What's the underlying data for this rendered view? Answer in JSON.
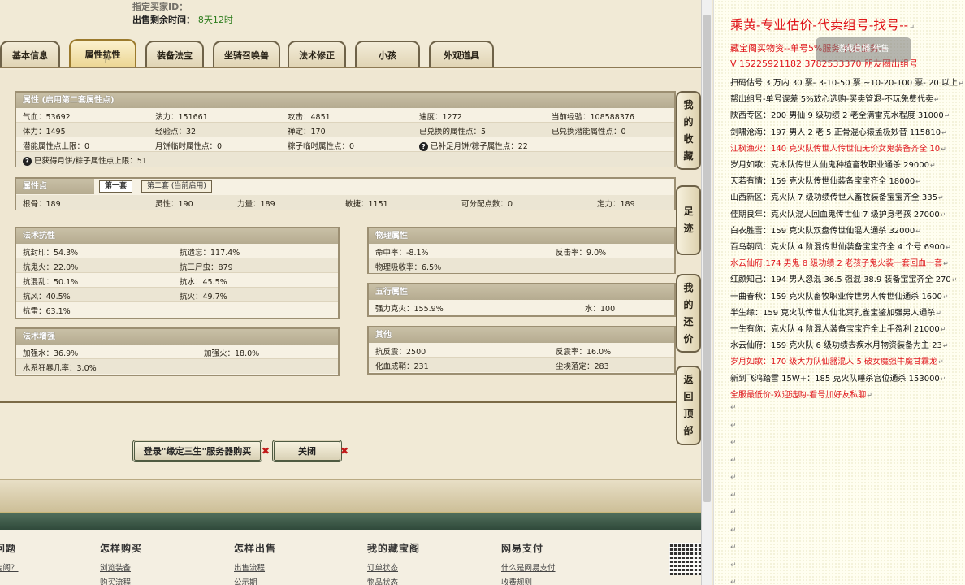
{
  "header": {
    "partial_line": "指定买家ID：",
    "time_label": "出售剩余时间：",
    "time_value": "8天12时"
  },
  "tabs": [
    {
      "label": "基本信息"
    },
    {
      "label": "属性抗性"
    },
    {
      "label": "装备法宝"
    },
    {
      "label": "坐骑召唤兽"
    },
    {
      "label": "法术修正"
    },
    {
      "label": "小孩"
    },
    {
      "label": "外观道具"
    }
  ],
  "attributes": {
    "title": "属性 (启用第二套属性点)",
    "row1": [
      "气血：53692",
      "法力：151661",
      "攻击：4851",
      "速度：1272",
      "当前经验：108588376"
    ],
    "row2": [
      "体力：1495",
      "经验点：32",
      "禅定：170",
      "已兑换的属性点：5",
      "已兑换潜能属性点：0"
    ],
    "row3": [
      "潜能属性点上限：0",
      "月饼临时属性点：0",
      "粽子临时属性点：0",
      "已补足月饼/粽子属性点：22"
    ],
    "row4": [
      "已获得月饼/粽子属性点上限：51"
    ]
  },
  "points": {
    "title": "属性点",
    "tab1": "第一套",
    "tab2": "第二套 (当前启用)",
    "row": [
      "根骨：189",
      "灵性：190",
      "力量：189",
      "敏捷：1151",
      "可分配点数：0",
      "定力：189"
    ]
  },
  "resist": {
    "title": "法术抗性",
    "rows": [
      [
        "抗封印：54.3%",
        "抗遗忘：117.4%"
      ],
      [
        "抗鬼火：22.0%",
        "抗三尸虫：879"
      ],
      [
        "抗混乱：50.1%",
        "抗水：45.5%"
      ],
      [
        "抗风：40.5%",
        "抗火：49.7%"
      ],
      [
        "抗雷：63.1%",
        ""
      ]
    ]
  },
  "physical": {
    "title": "物理属性",
    "rows": [
      [
        "命中率：-8.1%",
        "反击率：9.0%"
      ],
      [
        "物理吸收率：6.5%",
        ""
      ]
    ]
  },
  "wuxing": {
    "title": "五行属性",
    "rows": [
      [
        "强力克火：155.9%",
        "水：100"
      ]
    ]
  },
  "enhance": {
    "title": "法术增强",
    "rows": [
      [
        "加强水：36.9%",
        "加强火：18.0%"
      ],
      [
        "水系狂暴几率：3.0%",
        ""
      ]
    ]
  },
  "other": {
    "title": "其他",
    "rows": [
      [
        "抗反震：2500",
        "反震率：16.0%"
      ],
      [
        "化血成鞘：231",
        "尘埃落定：283"
      ]
    ]
  },
  "side_buttons": [
    {
      "label": [
        "我",
        "的",
        "收",
        "藏"
      ]
    },
    {
      "label": [
        "足",
        "迹"
      ]
    },
    {
      "label": [
        "我",
        "的",
        "还",
        "价"
      ]
    },
    {
      "label": [
        "返",
        "回",
        "顶",
        "部"
      ]
    }
  ],
  "actions": {
    "login_buy": "登录\"缘定三生\"服务器购买",
    "close": "关闭",
    "x_mark": "✖"
  },
  "footer": [
    {
      "heading": "问题",
      "links": [
        "宝阁？",
        ""
      ]
    },
    {
      "heading": "怎样购买",
      "links": [
        "浏览装备",
        "购买流程"
      ]
    },
    {
      "heading": "怎样出售",
      "links": [
        "出售流程",
        "公示期"
      ]
    },
    {
      "heading": "我的藏宝阁",
      "links": [
        "订单状态",
        "物品状态"
      ]
    },
    {
      "heading": "网易支付",
      "links": [
        "什么是网易支付",
        "收费规则"
      ]
    }
  ],
  "document": {
    "title": "乘黄-专业估价-代卖组号-找号--",
    "sub1": "藏宝阁买物资--单号5%服务 代卖业务--",
    "sub2": "V 15225921182 3782533370 朋友圈出组号",
    "watermark": "游戏直播 代售",
    "lines": [
      {
        "text": "扫码估号 3 万内 30 票- 3-10-50 票 ~10-20-100 票- 20 以上",
        "red": false
      },
      {
        "text": "帮出组号-单号误差 5%放心选购-买卖管退-不玩免费代卖",
        "red": false
      },
      {
        "text": "陕西专区：200 男仙 9 级功绩 2 老全满雷克水程度 31000",
        "red": false
      },
      {
        "text": "剑啸沧海：197 男人 2 老 5 正骨混心猿孟极妙音 115810",
        "red": false
      },
      {
        "text": "江枫渔火：140 克火队传世人传世仙无价女鬼装备齐全 10",
        "red": true
      },
      {
        "text": "岁月如歌：克木队传世人仙鬼种植畜牧职业通杀 29000",
        "red": false
      },
      {
        "text": "天若有情：159 克火队传世仙装备宝宝齐全 18000",
        "red": false
      },
      {
        "text": "山西新区：克火队 7 级功绩传世人畜牧装备宝宝齐全 335",
        "red": false
      },
      {
        "text": "佳期良年：克火队混人回血鬼传世仙 7 级护身老孩 27000",
        "red": false
      },
      {
        "text": "白衣胜雪：159 克火队双盘传世仙混人通杀 32000",
        "red": false
      },
      {
        "text": "百鸟朝凤：克火队 4 阶混传世仙装备宝宝齐全 4 个号 6900",
        "red": false
      },
      {
        "text": "水云仙府:174 男鬼 8 级功绩 2 老孩子鬼火装一套回血一套",
        "red": true
      },
      {
        "text": "红颜知己：194 男人忽混 36.5 强混 38.9 装备宝宝齐全 270",
        "red": false
      },
      {
        "text": "一曲春秋：159 克火队畜牧职业传世男人传世仙通杀 1600",
        "red": false
      },
      {
        "text": "半生缘：159 克火队传世人仙北冥孔雀宝鉴加强男人通杀",
        "red": false
      },
      {
        "text": "一生有你：克火队 4 阶混人装备宝宝齐全上手盈利 21000",
        "red": false
      },
      {
        "text": "水云仙府：159 克火队 6 级功绩去疾水月物资装备为主 23",
        "red": false
      },
      {
        "text": "岁月如歌：170 级大力队仙器混人 5 破女魔强牛魔甘霖龙",
        "red": true
      },
      {
        "text": "新到飞鸿踏雪 15W+：185 克火队睡杀宫位通杀 153000",
        "red": false
      },
      {
        "text": "全服最低价-欢迎选购-看号加好友私聊",
        "red": true
      }
    ],
    "return_mark": "↵"
  }
}
